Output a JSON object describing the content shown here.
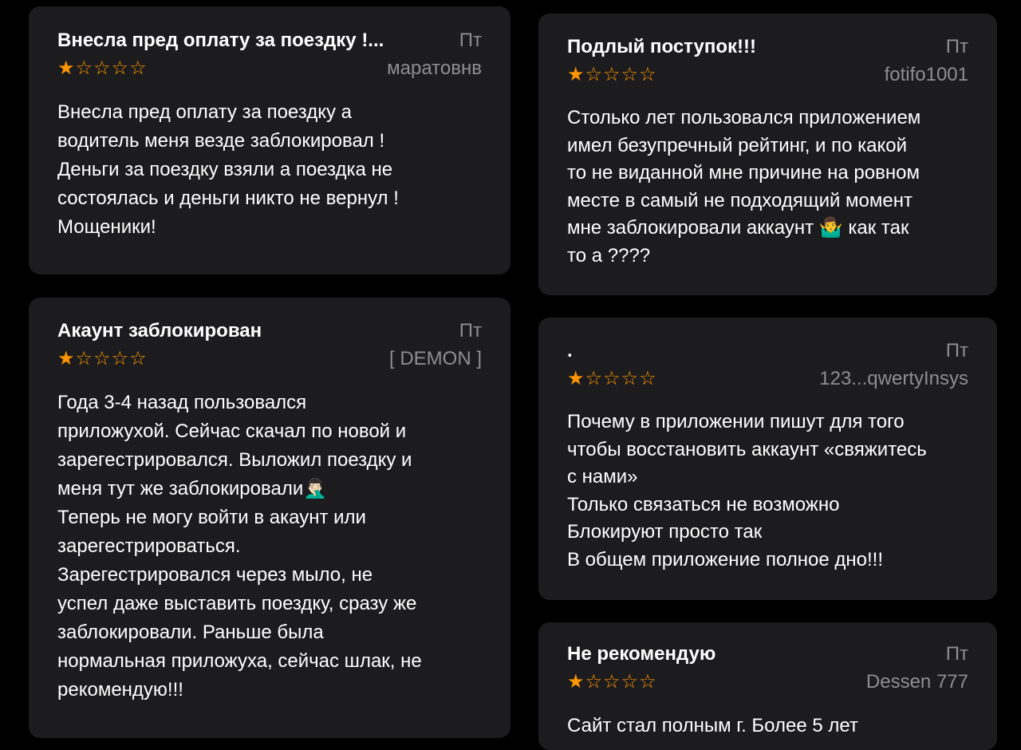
{
  "reviews": [
    {
      "title": "Внесла пред оплату за поездку !...",
      "date": "Пт",
      "author": "маратовнв",
      "rating": 1,
      "max_rating": 5,
      "body": "Внесла пред оплату за поездку а\nводитель меня везде заблокировал !\nДеньги за поездку взяли а поездка не\nсостоялась и деньги никто не вернул !\nМощеники!"
    },
    {
      "title": "Подлый поступок!!!",
      "date": "Пт",
      "author": "fotifo1001",
      "rating": 1,
      "max_rating": 5,
      "body": "Столько лет пользовался приложением\nимел безупречный рейтинг, и по какой\nто не виданной мне причине на ровном\nместе в самый не подходящий момент\nмне заблокировали аккаунт 🤷‍♂️ как так\nто а ????"
    },
    {
      "title": "Акаунт заблокирован",
      "date": "Пт",
      "author": "[ DEMON ]",
      "rating": 1,
      "max_rating": 5,
      "body": "Года 3-4 назад пользовался\nприложухой. Сейчас скачал по новой и\nзарегестрировался. Выложил поездку и\nменя тут же заблокировали🤦🏻‍♂️\nТеперь не могу войти в акаунт или\nзарегестрироваться.\nЗарегестрировался через мыло, не\nуспел даже выставить поездку, сразу же\nзаблокировали. Раньше была\nнормальная приложуха, сейчас шлак, не\nрекомендую!!!"
    },
    {
      "title": ".",
      "date": "Пт",
      "author": "123...qwertyInsys",
      "rating": 1,
      "max_rating": 5,
      "body": "Почему в приложении пишут для того\nчтобы восстановить аккаунт «свяжитесь\nс нами»\nТолько связаться не возможно\nБлокируют просто так\nВ общем приложение полное дно!!!"
    },
    {
      "title": "Не рекомендую",
      "date": "Пт",
      "author": "Dessen 777",
      "rating": 1,
      "max_rating": 5,
      "body": "Сайт стал полным г.  Более 5 лет"
    }
  ],
  "colors": {
    "background": "#000000",
    "card": "#1c1c1e",
    "star": "#ff9500",
    "secondary_text": "#8e8e93",
    "primary_text": "#ffffff"
  },
  "icons": {
    "star_filled": "star-filled-icon",
    "star_empty": "star-empty-icon"
  }
}
